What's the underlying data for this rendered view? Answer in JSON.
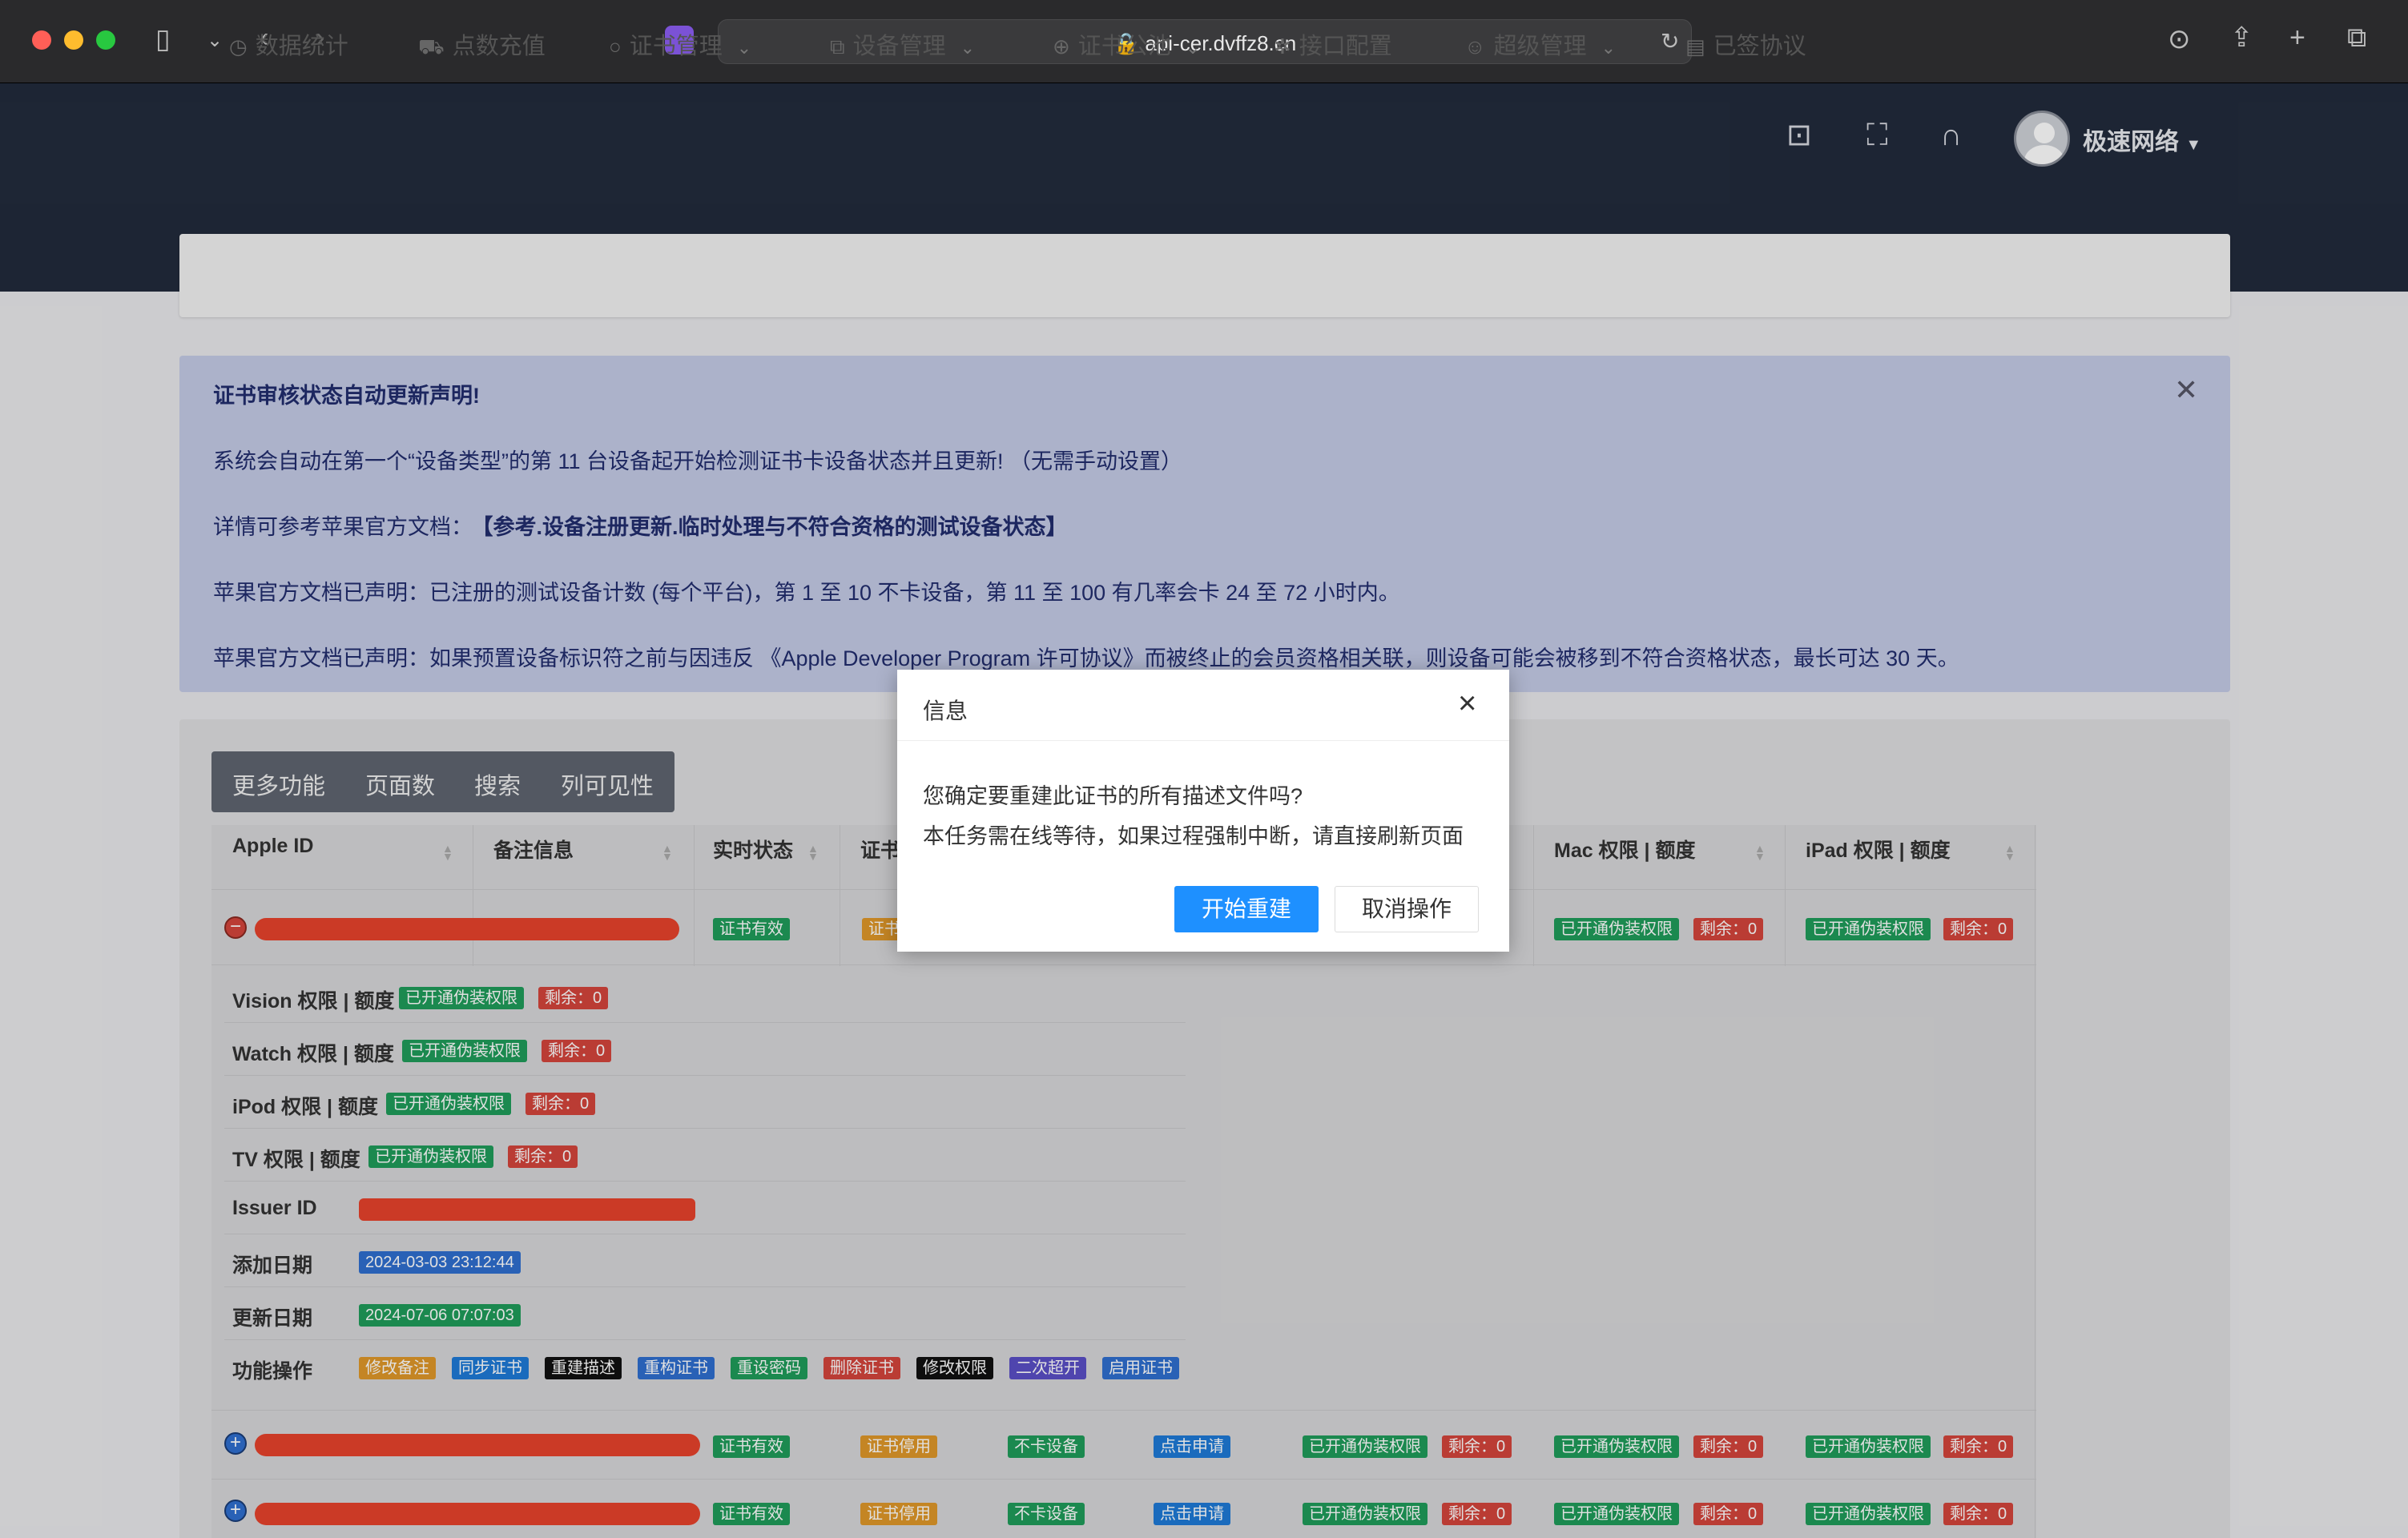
{
  "browser": {
    "url": "api-cer.dvffz8.cn"
  },
  "header": {
    "username": "极速网络"
  },
  "nav": {
    "items": [
      {
        "label": "数据统计"
      },
      {
        "label": "点数充值"
      },
      {
        "label": "证书管理"
      },
      {
        "label": "设备管理"
      },
      {
        "label": "证书公池"
      },
      {
        "label": "接口配置"
      },
      {
        "label": "超级管理"
      },
      {
        "label": "已签协议"
      }
    ]
  },
  "notice": {
    "title": "证书审核状态自动更新声明!",
    "line1": "系统会自动在第一个“设备类型”的第 11 台设备起开始检测证书卡设备状态并且更新! （无需手动设置）",
    "line2_prefix": "详情可参考苹果官方文档：",
    "line2_link": "【参考.设备注册更新.临时处理与不符合资格的测试设备状态】",
    "line3": "苹果官方文档已声明：已注册的测试设备计数 (每个平台)，第 1 至 10 不卡设备，第 11 至 100 有几率会卡 24 至 72 小时内。",
    "line4": "苹果官方文档已声明：如果预置设备标识符之前与因违反 《Apple Developer Program 许可协议》而被终止的会员资格相关联，则设备可能会被移到不符合资格状态，最长可达 30 天。"
  },
  "toolbar": {
    "more": "更多功能",
    "pages": "页面数",
    "search": "搜索",
    "columns": "列可见性"
  },
  "table": {
    "headers": {
      "apple_id": "Apple ID",
      "remark": "备注信息",
      "status": "实时状态",
      "cert": "证书",
      "mac": "Mac 权限 | 额度",
      "ipad": "iPad 权限 | 额度"
    },
    "badges": {
      "cert_valid": "证书有效",
      "cert_stopped": "证书停用",
      "no_block": "不卡设备",
      "click_apply": "点击申请",
      "pseudo": "已开通伪装权限",
      "remaining": "剩余：0"
    },
    "details": {
      "vision": "Vision 权限 | 额度",
      "watch": "Watch 权限 | 额度",
      "ipod": "iPod 权限 | 额度",
      "tv": "TV 权限 | 额度",
      "issuer": "Issuer ID",
      "added": "添加日期",
      "added_value": "2024-03-03 23:12:44",
      "updated": "更新日期",
      "updated_value": "2024-07-06 07:07:03",
      "actions": "功能操作"
    },
    "actions": [
      "修改备注",
      "同步证书",
      "重建描述",
      "重构证书",
      "重设密码",
      "删除证书",
      "修改权限",
      "二次超开",
      "启用证书"
    ]
  },
  "dialog": {
    "title": "信息",
    "message1": "您确定要重建此证书的所有描述文件吗?",
    "message2": "本任务需在线等待，如果过程强制中断，请直接刷新页面",
    "confirm": "开始重建",
    "cancel": "取消操作"
  }
}
